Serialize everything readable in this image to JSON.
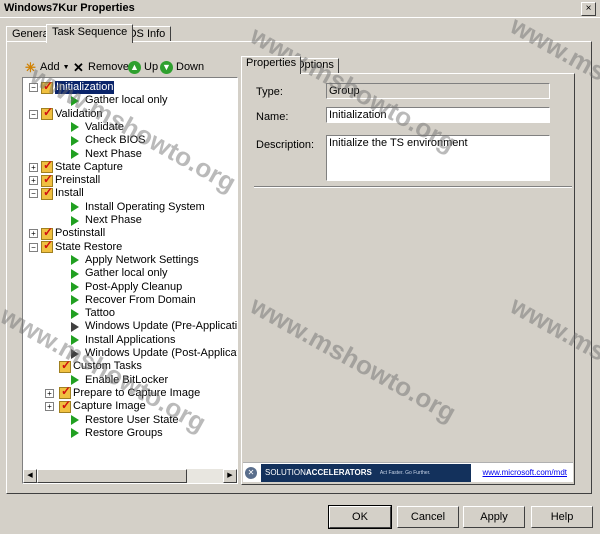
{
  "window": {
    "title": "Windows7Kur Properties",
    "close_glyph": "×"
  },
  "tabs": [
    {
      "label": "General"
    },
    {
      "label": "Task Sequence"
    },
    {
      "label": "OS Info"
    }
  ],
  "toolbar": {
    "add_label": "Add",
    "remove_label": "Remove",
    "up_label": "Up",
    "down_label": "Down",
    "add_glyph": "✳",
    "remove_glyph": "✕",
    "up_glyph": "▲",
    "down_glyph": "▼",
    "caret_glyph": "▼"
  },
  "tree": [
    {
      "label": "Initialization",
      "level": 0,
      "type": "group",
      "expander": "−",
      "selected": true
    },
    {
      "label": "Gather local only",
      "level": 1,
      "type": "step"
    },
    {
      "label": "Validation",
      "level": 0,
      "type": "group",
      "expander": "−"
    },
    {
      "label": "Validate",
      "level": 1,
      "type": "step"
    },
    {
      "label": "Check BIOS",
      "level": 1,
      "type": "step"
    },
    {
      "label": "Next Phase",
      "level": 1,
      "type": "step"
    },
    {
      "label": "State Capture",
      "level": 0,
      "type": "group",
      "expander": "+"
    },
    {
      "label": "Preinstall",
      "level": 0,
      "type": "group",
      "expander": "+"
    },
    {
      "label": "Install",
      "level": 0,
      "type": "group",
      "expander": "−"
    },
    {
      "label": "Install Operating System",
      "level": 1,
      "type": "step"
    },
    {
      "label": "Next Phase",
      "level": 1,
      "type": "step"
    },
    {
      "label": "Postinstall",
      "level": 0,
      "type": "group",
      "expander": "+"
    },
    {
      "label": "State Restore",
      "level": 0,
      "type": "group",
      "expander": "−"
    },
    {
      "label": "Apply Network Settings",
      "level": 1,
      "type": "step"
    },
    {
      "label": "Gather local only",
      "level": 1,
      "type": "step"
    },
    {
      "label": "Post-Apply Cleanup",
      "level": 1,
      "type": "step"
    },
    {
      "label": "Recover From Domain",
      "level": 1,
      "type": "step"
    },
    {
      "label": "Tattoo",
      "level": 1,
      "type": "step"
    },
    {
      "label": "Windows Update (Pre-Application Installa",
      "level": 1,
      "type": "step",
      "dark": true
    },
    {
      "label": "Install Applications",
      "level": 1,
      "type": "step"
    },
    {
      "label": "Windows Update (Post-Application Install",
      "level": 1,
      "type": "step",
      "dark": true
    },
    {
      "label": "Custom Tasks",
      "level": 1,
      "type": "group"
    },
    {
      "label": "Enable BitLocker",
      "level": 1,
      "type": "step"
    },
    {
      "label": "Prepare to Capture Image",
      "level": 1,
      "type": "group",
      "expander": "+"
    },
    {
      "label": "Capture Image",
      "level": 1,
      "type": "group",
      "expander": "+"
    },
    {
      "label": "Restore User State",
      "level": 1,
      "type": "step"
    },
    {
      "label": "Restore Groups",
      "level": 1,
      "type": "step"
    }
  ],
  "scrollbar": {
    "left_glyph": "◀",
    "right_glyph": "▶"
  },
  "properties": {
    "tabs": [
      {
        "label": "Properties"
      },
      {
        "label": "Options"
      }
    ],
    "type_label": "Type:",
    "type_value": "Group",
    "name_label": "Name:",
    "name_value": "Initialization",
    "description_label": "Description:",
    "description_value": "Initialize the TS environment"
  },
  "banner": {
    "logo_glyph": "✕",
    "brand_prefix": "SOLUTION",
    "brand_suffix": "ACCELERATORS",
    "tagline": "Act Faster. Go Further.",
    "url": "www.microsoft.com/mdt"
  },
  "buttons": {
    "ok": "OK",
    "cancel": "Cancel",
    "apply": "Apply",
    "help": "Help"
  },
  "watermark": "www.mshowto.org"
}
